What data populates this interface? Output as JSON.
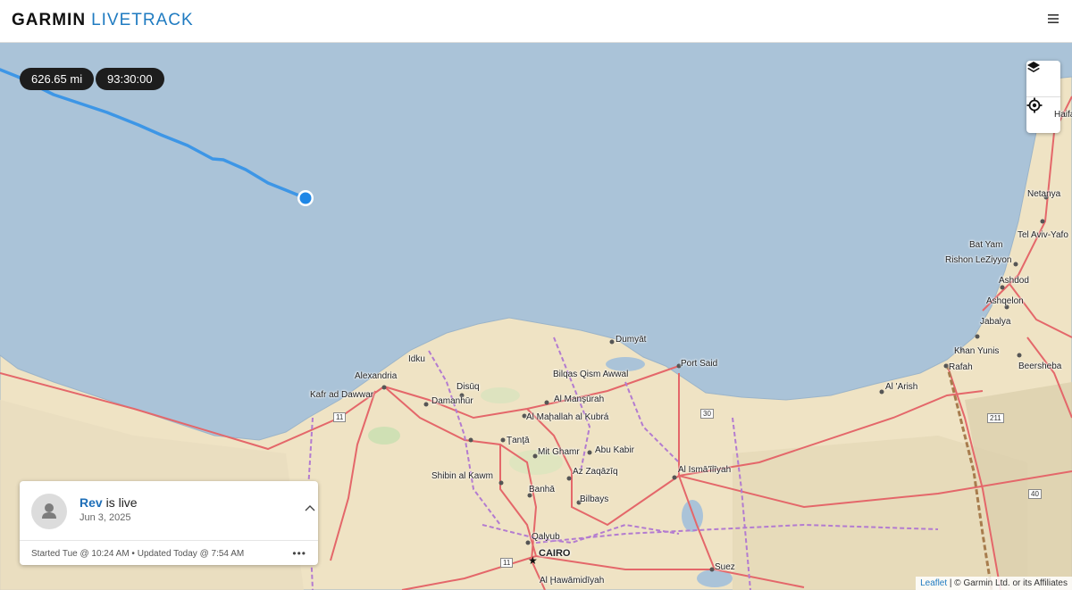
{
  "header": {
    "brand_primary": "GARMIN",
    "brand_secondary": "LIVETRACK",
    "menu_icon": "hamburger-icon"
  },
  "stats": {
    "distance": "626.65 mi",
    "duration": "93:30:00"
  },
  "map_controls": {
    "layers_icon": "layers-icon",
    "locate_icon": "crosshair-icon"
  },
  "map_labels": {
    "haifa": "Haifa",
    "netanya": "Netanya",
    "tel_aviv": "Tel Aviv-Yafo",
    "bat_yam": "Bat Yam",
    "rishon": "Rishon LeZiyyon",
    "ashdod": "Ashdod",
    "ashqelon": "Ashqelon",
    "jabalya": "Jabalya",
    "khan_yunis": "Khan Yunis",
    "rafah": "Rafah",
    "beersheba": "Beersheba",
    "al_arish": "Al 'Arish",
    "port_said": "Port Said",
    "dumyat": "Dumyāt",
    "bilqas": "Bilqas Qism Awwal",
    "idku": "Idku",
    "alexandria": "Alexandria",
    "kafr": "Kafr ad Dawwar",
    "disuq": "Disūq",
    "damanhur": "Damanhūr",
    "mansurah": "Al Manşūrah",
    "mahallah": "Al Maḩallah al Kubrá",
    "tanta": "Ţanţā",
    "mit_ghamr": "Mit Ghamr",
    "abu_kabir": "Abu Kabir",
    "zaqaziq": "Az Zaqāzīq",
    "shibin": "Shibin al Kawm",
    "banha": "Banhā",
    "bilbays": "Bilbays",
    "ismailiyah": "Al Ismā'īlīyah",
    "qalyub": "Qalyub",
    "cairo": "CAIRO",
    "suez": "Suez",
    "hawamidiyah": "Al Ḩawāmidīyah"
  },
  "road_shields": {
    "r11a": "11",
    "r30": "30",
    "r211": "211",
    "r40": "40",
    "r11b": "11"
  },
  "card": {
    "name": "Rev",
    "status": "is live",
    "date": "Jun 3, 2025",
    "meta": "Started Tue @ 10:24 AM • Updated Today @ 7:54 AM",
    "more_label": "•••"
  },
  "attribution": {
    "link": "Leaflet",
    "text": " | © Garmin Ltd. or its Affiliates"
  },
  "colors": {
    "sea": "#aac3d8",
    "land": "#efe3c4",
    "track": "#3d96e6",
    "accent": "#1f7bc1"
  }
}
